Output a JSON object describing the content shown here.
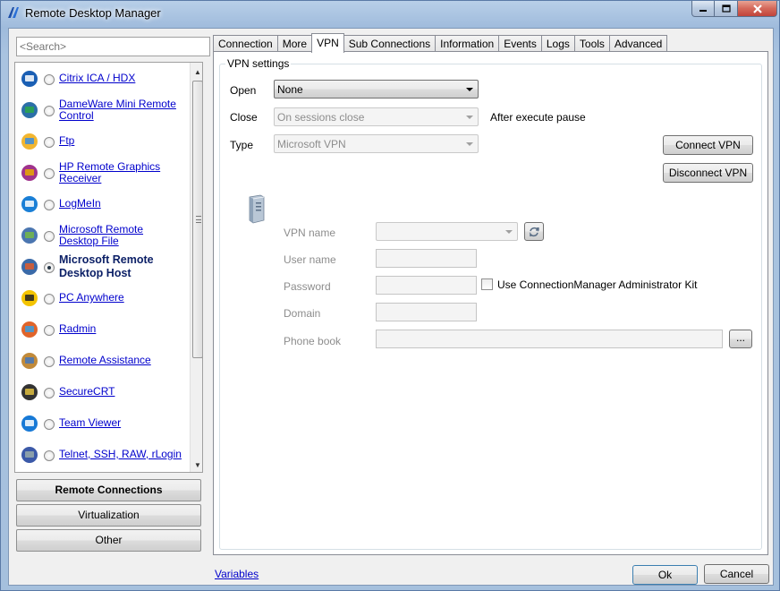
{
  "window": {
    "title": "Remote Desktop Manager"
  },
  "search": {
    "placeholder": "<Search>"
  },
  "sidebar": {
    "items": [
      {
        "label": "Citrix ICA / HDX",
        "icon": "citrix-icon",
        "selected": false
      },
      {
        "label": "DameWare Mini Remote Control",
        "icon": "dameware-icon",
        "selected": false
      },
      {
        "label": "Ftp",
        "icon": "ftp-icon",
        "selected": false
      },
      {
        "label": "HP Remote Graphics Receiver",
        "icon": "hp-rgs-icon",
        "selected": false
      },
      {
        "label": "LogMeIn",
        "icon": "logmein-icon",
        "selected": false
      },
      {
        "label": "Microsoft Remote Desktop File",
        "icon": "rdp-file-icon",
        "selected": false
      },
      {
        "label": "Microsoft Remote Desktop Host",
        "icon": "rdp-host-icon",
        "selected": true
      },
      {
        "label": "PC Anywhere",
        "icon": "pcanywhere-icon",
        "selected": false
      },
      {
        "label": "Radmin",
        "icon": "radmin-icon",
        "selected": false
      },
      {
        "label": "Remote Assistance",
        "icon": "remote-assistance-icon",
        "selected": false
      },
      {
        "label": "SecureCRT",
        "icon": "securecrt-icon",
        "selected": false
      },
      {
        "label": "Team Viewer",
        "icon": "teamviewer-icon",
        "selected": false
      },
      {
        "label": "Telnet, SSH, RAW, rLogin",
        "icon": "telnet-icon",
        "selected": false
      }
    ],
    "categories": [
      "Remote Connections",
      "Virtualization",
      "Other"
    ]
  },
  "tabs": [
    "Connection",
    "More",
    "VPN",
    "Sub Connections",
    "Information",
    "Events",
    "Logs",
    "Tools",
    "Advanced"
  ],
  "active_tab": "VPN",
  "vpn": {
    "group_title": "VPN settings",
    "open_label": "Open",
    "open_value": "None",
    "close_label": "Close",
    "close_value": "On sessions close",
    "after_execute_pause": "After execute pause",
    "type_label": "Type",
    "type_value": "Microsoft VPN",
    "connect_button": "Connect VPN",
    "disconnect_button": "Disconnect VPN",
    "vpn_name_label": "VPN name",
    "user_name_label": "User name",
    "password_label": "Password",
    "use_cmak_label": "Use ConnectionManager Administrator Kit",
    "domain_label": "Domain",
    "phone_book_label": "Phone book",
    "browse_button": "..."
  },
  "footer": {
    "variables_link": "Variables",
    "ok_button": "Ok",
    "cancel_button": "Cancel"
  }
}
